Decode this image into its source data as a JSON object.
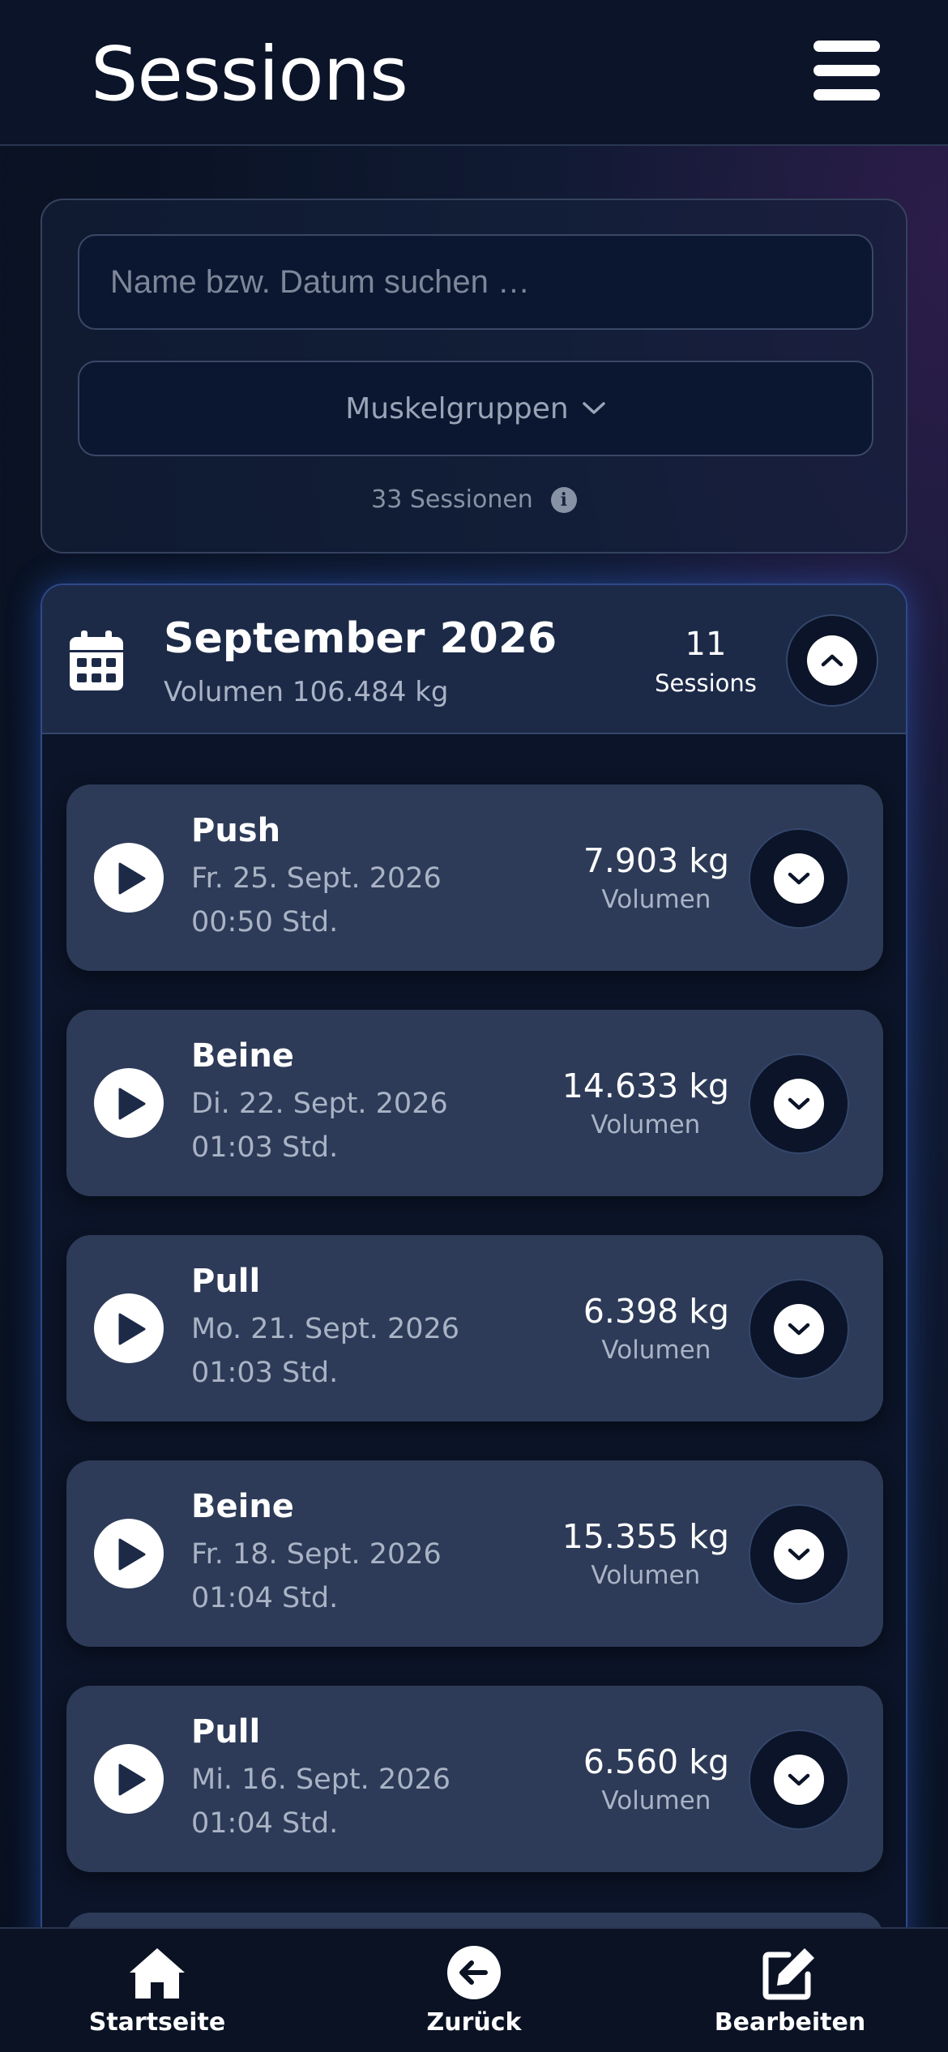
{
  "header": {
    "title": "Sessions",
    "menu_icon": "hamburger-menu-icon"
  },
  "filter": {
    "search_placeholder": "Name bzw. Datum suchen …",
    "muscle_group_label": "Muskelgruppen",
    "session_count": "33 Sessionen"
  },
  "month": {
    "title": "September 2026",
    "volume": "Volumen 106.484 kg",
    "count": "11",
    "count_label": "Sessions",
    "expanded": true
  },
  "sessions": [
    {
      "name": "Push",
      "date": "Fr. 25. Sept. 2026",
      "duration": "00:50 Std.",
      "volume": "7.903 kg",
      "volume_label": "Volumen"
    },
    {
      "name": "Beine",
      "date": "Di. 22. Sept. 2026",
      "duration": "01:03 Std.",
      "volume": "14.633 kg",
      "volume_label": "Volumen"
    },
    {
      "name": "Pull",
      "date": "Mo. 21. Sept. 2026",
      "duration": "01:03 Std.",
      "volume": "6.398 kg",
      "volume_label": "Volumen"
    },
    {
      "name": "Beine",
      "date": "Fr. 18. Sept. 2026",
      "duration": "01:04 Std.",
      "volume": "15.355 kg",
      "volume_label": "Volumen"
    },
    {
      "name": "Pull",
      "date": "Mi. 16. Sept. 2026",
      "duration": "01:04 Std.",
      "volume": "6.560 kg",
      "volume_label": "Volumen"
    }
  ],
  "nav": {
    "home": "Startseite",
    "back": "Zurück",
    "edit": "Bearbeiten"
  }
}
